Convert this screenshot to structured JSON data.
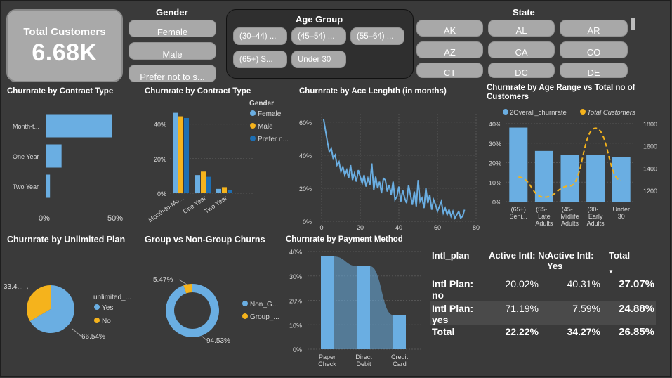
{
  "card": {
    "label": "Total Customers",
    "value": "6.68K"
  },
  "gender": {
    "title": "Gender",
    "items": [
      "Female",
      "Male",
      "Prefer not to s..."
    ]
  },
  "age_group": {
    "title": "Age Group",
    "items": [
      "(30–44) ...",
      "(45–54) ...",
      "(55–64) ...",
      "(65+) S...",
      "Under 30"
    ]
  },
  "state": {
    "title": "State",
    "items": [
      "AK",
      "AL",
      "AR",
      "AZ",
      "CA",
      "CO",
      "CT",
      "DC",
      "DE"
    ]
  },
  "colors": {
    "light_blue": "#6aaee2",
    "orange": "#f5b31c",
    "dark_blue": "#1e6fb3",
    "text_gray": "#d8d8d8"
  },
  "chart_data": [
    {
      "id": "contract_bar",
      "type": "bar",
      "title": "Churnrate by Contract Type",
      "orientation": "horizontal",
      "categories": [
        "Month-t...",
        "One Year",
        "Two Year"
      ],
      "values": [
        46,
        11,
        3
      ],
      "x_ticks": [
        "0%",
        "50%"
      ],
      "xlim": [
        0,
        50
      ]
    },
    {
      "id": "contract_gender",
      "type": "bar",
      "title": "Churnrate by Contract Type",
      "categories": [
        "Month-to-Mo...",
        "One Year",
        "Two Year"
      ],
      "series": [
        {
          "name": "Female",
          "values": [
            46.5,
            10.5,
            2.5
          ]
        },
        {
          "name": "Male",
          "values": [
            44.5,
            12.5,
            3.5
          ]
        },
        {
          "name": "Prefer n...",
          "values": [
            43.5,
            9.5,
            2.0
          ]
        }
      ],
      "legend_title": "Gender",
      "y_ticks": [
        "0%",
        "20%",
        "40%"
      ],
      "ylim": [
        0,
        50
      ]
    },
    {
      "id": "acc_length",
      "type": "line",
      "title": "Churnrate by Acc Lenghth (in months)",
      "x": [
        1,
        2,
        3,
        4,
        5,
        6,
        7,
        8,
        9,
        10,
        11,
        12,
        13,
        14,
        15,
        16,
        17,
        18,
        19,
        20,
        21,
        22,
        23,
        24,
        25,
        26,
        27,
        28,
        29,
        30,
        31,
        32,
        33,
        34,
        35,
        36,
        37,
        38,
        39,
        40,
        41,
        42,
        43,
        44,
        45,
        46,
        47,
        48,
        49,
        50,
        51,
        52,
        53,
        54,
        55,
        56,
        57,
        58,
        59,
        60,
        61,
        62,
        63,
        64,
        65,
        66,
        67,
        68,
        69,
        70,
        71,
        72,
        73,
        74
      ],
      "y": [
        62,
        55,
        48,
        42,
        44,
        38,
        40,
        34,
        36,
        30,
        33,
        28,
        31,
        26,
        34,
        25,
        29,
        24,
        31,
        27,
        23,
        28,
        21,
        26,
        22,
        35,
        19,
        27,
        20,
        24,
        17,
        26,
        25,
        18,
        22,
        16,
        24,
        13,
        15,
        21,
        12,
        19,
        14,
        11,
        22,
        16,
        10,
        18,
        9,
        25,
        12,
        14,
        8,
        20,
        11,
        16,
        7,
        13,
        10,
        6,
        9,
        12,
        5,
        8,
        4,
        7,
        3,
        6,
        2,
        4,
        6,
        2,
        3,
        7
      ],
      "x_ticks": [
        "0",
        "20",
        "40",
        "60",
        "80"
      ],
      "y_ticks": [
        "0%",
        "20%",
        "40%",
        "60%"
      ],
      "xlim": [
        0,
        80
      ],
      "ylim": [
        0,
        65
      ]
    },
    {
      "id": "age_combo",
      "type": "bar",
      "title": "Churnrate by Age Range vs Total no of Customers",
      "categories": [
        "(65+) Seni...",
        "(55-... Late Adults",
        "(45-... Midlife Adults",
        "(30-... Early Adults",
        "Under 30"
      ],
      "series": [
        {
          "name": "2Overall_churnrate",
          "values": [
            38,
            26,
            24,
            24,
            23
          ]
        },
        {
          "name": "Total Customers",
          "values": [
            1320,
            1140,
            1240,
            1760,
            1290
          ]
        }
      ],
      "y_ticks": [
        "0%",
        "10%",
        "20%",
        "30%",
        "40%"
      ],
      "y2_ticks": [
        "1200",
        "1400",
        "1600",
        "1800"
      ],
      "ylim": [
        0,
        40
      ],
      "y2lim": [
        1100,
        1800
      ]
    },
    {
      "id": "unlimited_pie",
      "type": "pie",
      "title": "Churnrate by Unlimited Plan",
      "legend_title": "unlimited_...",
      "categories": [
        "Yes",
        "No"
      ],
      "values": [
        66.54,
        33.46
      ],
      "labels": [
        "66.54%",
        "33.4..."
      ]
    },
    {
      "id": "group_donut",
      "type": "pie",
      "title": "Group vs Non-Group Churns",
      "categories": [
        "Non_G...",
        "Group_..."
      ],
      "values": [
        94.53,
        5.47
      ],
      "labels": [
        "94.53%",
        "5.47%"
      ]
    },
    {
      "id": "payment_ribbon",
      "type": "bar",
      "title": "Churnrate by Payment Method",
      "categories": [
        "Paper Check",
        "Direct Debit",
        "Credit Card"
      ],
      "values": [
        38,
        34,
        14
      ],
      "y_ticks": [
        "0%",
        "10%",
        "20%",
        "30%",
        "40%"
      ],
      "ylim": [
        0,
        40
      ]
    },
    {
      "id": "intl_table",
      "type": "table",
      "columns": [
        "Intl_plan",
        "Active Intl: No",
        "Active Intl: Yes",
        "Total"
      ],
      "rows": [
        [
          "Intl Plan: no",
          "20.02%",
          "40.31%",
          "27.07%"
        ],
        [
          "Intl Plan: yes",
          "71.19%",
          "7.59%",
          "24.88%"
        ],
        [
          "Total",
          "22.22%",
          "34.27%",
          "26.85%"
        ]
      ]
    }
  ]
}
